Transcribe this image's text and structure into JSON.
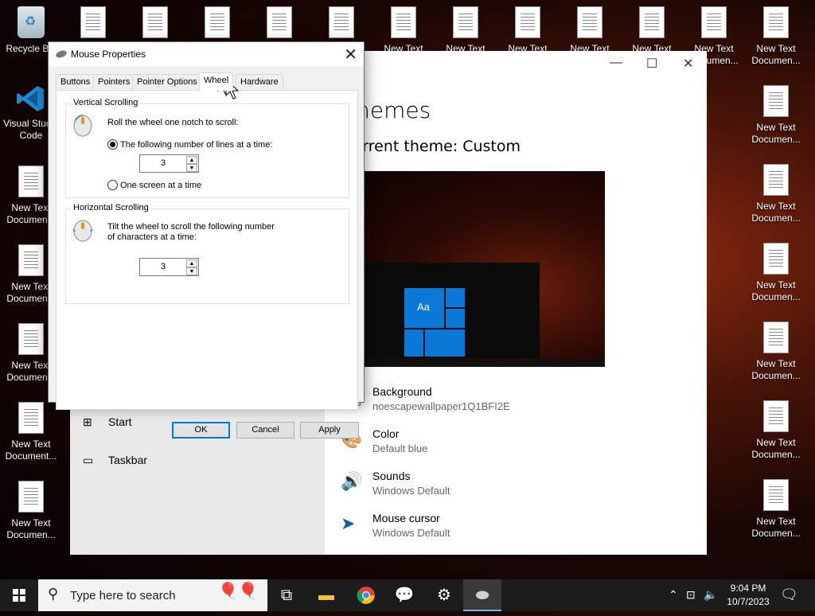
{
  "desktop": {
    "recycle_bin": "Recycle Bin",
    "vs_code_line1": "Visual Studio",
    "vs_code_line2": "Code",
    "doc_label_a": "New Text",
    "doc_label_b": "Document...",
    "doc_label_c": "Documen..."
  },
  "settings_window": {
    "controls": {
      "minimize": "—",
      "maximize": "☐",
      "close": "✕"
    },
    "page_title": "Themes",
    "current_theme": "Current theme: Custom",
    "preview_tile_text": "Aa",
    "items": [
      {
        "title": "Background",
        "subtitle": "noescapewallpaper1Q1BFI2E",
        "icon": "image-icon"
      },
      {
        "title": "Color",
        "subtitle": "Default blue",
        "icon": "palette-icon"
      },
      {
        "title": "Sounds",
        "subtitle": "Windows Default",
        "icon": "speaker-icon"
      },
      {
        "title": "Mouse cursor",
        "subtitle": "Windows Default",
        "icon": "cursor-icon"
      }
    ],
    "nav": [
      {
        "label": "Start",
        "icon": "start-icon"
      },
      {
        "label": "Taskbar",
        "icon": "taskbar-icon"
      }
    ]
  },
  "mouse_dialog": {
    "title": "Mouse Properties",
    "close": "✕",
    "tabs": [
      "Buttons",
      "Pointers",
      "Pointer Options",
      "Wheel",
      "Hardware"
    ],
    "active_tab": "Wheel",
    "vertical": {
      "caption": "Vertical Scrolling",
      "instruction": "Roll the wheel one notch to scroll:",
      "option_lines": "The following number of lines at a time:",
      "lines_value": "3",
      "option_screen": "One screen at a time",
      "selected": "lines"
    },
    "horizontal": {
      "caption": "Horizontal Scrolling",
      "instruction_line1": "Tilt the wheel to scroll the following number",
      "instruction_line2": "of characters at a time:",
      "chars_value": "3"
    },
    "buttons": {
      "ok": "OK",
      "cancel": "Cancel",
      "apply": "Apply"
    }
  },
  "taskbar": {
    "search_placeholder": "Type here to search",
    "apps": [
      "task-view-icon",
      "file-explorer-icon",
      "chrome-icon",
      "chat-icon",
      "settings-gear-icon",
      "mouse-properties-icon"
    ],
    "time": "9:04 PM",
    "date": "10/7/2023"
  },
  "colors": {
    "accent": "#0078d7",
    "tile_blue": "#0a78d7",
    "taskbar": "#1c1c1c"
  }
}
